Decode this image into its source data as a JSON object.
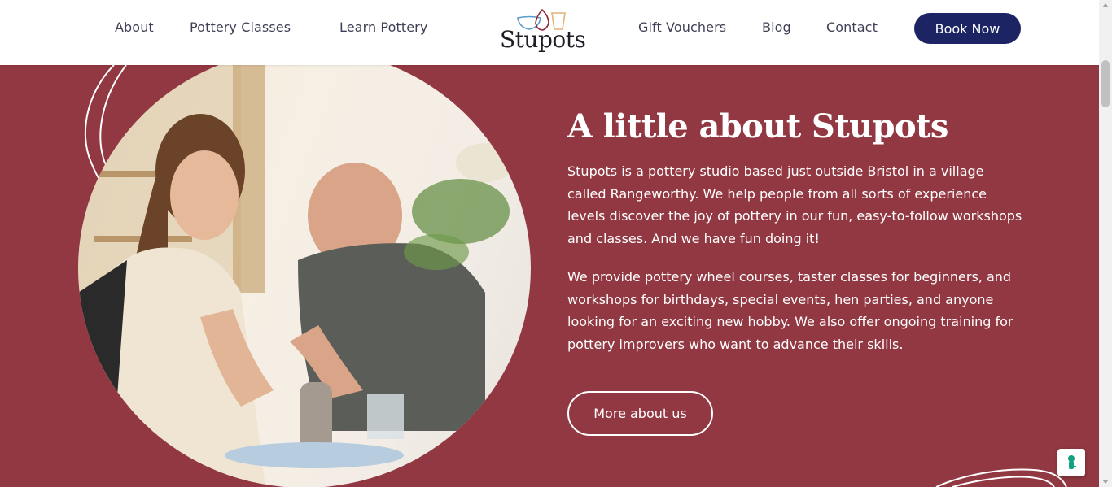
{
  "header": {
    "nav_left": [
      "About",
      "Pottery Classes",
      "Learn Pottery"
    ],
    "nav_right": [
      "Gift Vouchers",
      "Blog",
      "Contact"
    ],
    "logo_text": "Stupots",
    "book_button": "Book Now"
  },
  "about": {
    "heading": "A little about Stupots",
    "paragraph_1": "Stupots is a pottery studio based just outside Bristol in a village called Rangeworthy. We help people from all sorts of experience levels discover the joy of pottery in our fun, easy-to-follow workshops and classes. And we have fun doing it!",
    "paragraph_2": "We provide pottery wheel courses, taster classes for beginners, and workshops for birthdays, special events, hen parties, and anyone looking for an exciting new hobby. We also offer ongoing training for pottery improvers who want to advance their skills.",
    "more_button": "More about us",
    "photo_icon": "pottery-class-photo"
  },
  "widgets": {
    "cookie_icon": "cookie-settings-icon"
  },
  "colors": {
    "section_background": "#923842",
    "button_navy": "#1c2463",
    "nav_text": "#3f3f55",
    "white": "#ffffff"
  }
}
